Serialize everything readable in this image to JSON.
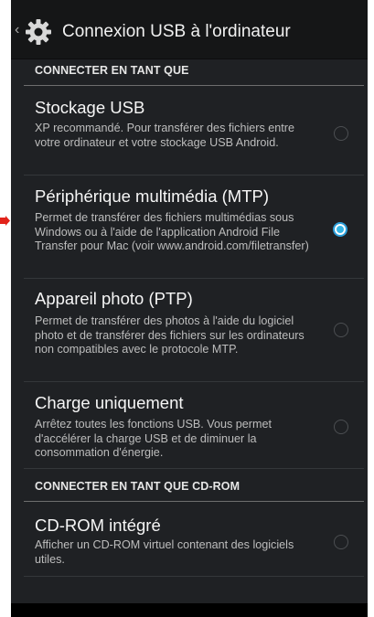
{
  "header": {
    "title": "Connexion USB à l'ordinateur",
    "back_glyph": "‹"
  },
  "sections": [
    {
      "header": "CONNECTER EN TANT QUE"
    },
    {
      "header": "CONNECTER EN TANT QUE CD-ROM"
    }
  ],
  "options": [
    {
      "title": "Stockage USB",
      "desc": "XP recommandé. Pour transférer des fichiers entre votre ordinateur et votre stockage USB Android.",
      "selected": false
    },
    {
      "title": "Périphérique multimédia (MTP)",
      "desc": "Permet de transférer des fichiers multimédias sous Windows ou à l'aide de l'application Android File Transfer pour Mac (voir www.android.com/filetransfer)",
      "selected": true
    },
    {
      "title": "Appareil photo (PTP)",
      "desc": "Permet de transférer des photos à l'aide du logiciel photo et de transférer des fichiers sur les ordinateurs non compatibles avec le protocole MTP.",
      "selected": false
    },
    {
      "title": "Charge uniquement",
      "desc": "Arrêtez toutes les fonctions USB. Vous permet d'accélérer la charge USB et de diminuer la consommation d'énergie.",
      "selected": false
    },
    {
      "title": "CD-ROM intégré",
      "desc": "Afficher un CD-ROM virtuel contenant des logiciels utiles.",
      "selected": false
    }
  ],
  "colors": {
    "accent": "#33b5e5",
    "annotation_arrow": "#e2231a"
  },
  "icons": {
    "header": "gear-icon",
    "annotation": "arrow-right-icon"
  }
}
